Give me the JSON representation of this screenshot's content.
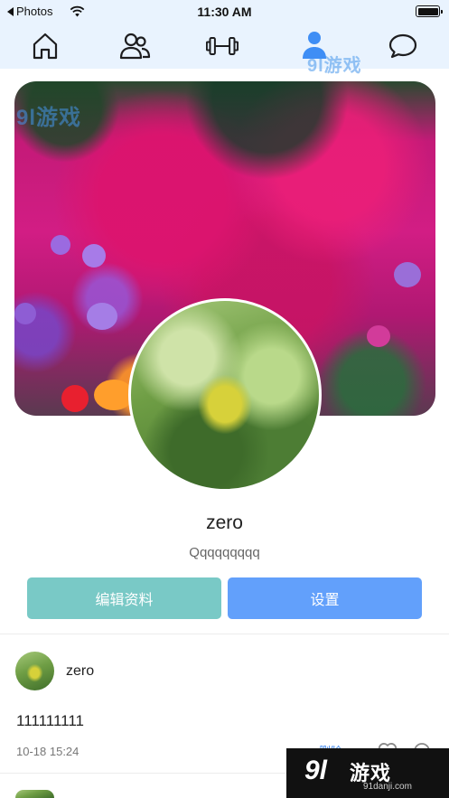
{
  "status_bar": {
    "back_label": "Photos",
    "time": "11:30 AM"
  },
  "tabs": [
    {
      "name": "home-icon",
      "active": false
    },
    {
      "name": "friends-icon",
      "active": false
    },
    {
      "name": "dumbbell-icon",
      "active": false
    },
    {
      "name": "user-icon",
      "active": true
    },
    {
      "name": "chat-bubble-icon",
      "active": false
    }
  ],
  "watermark": {
    "logo": "9l游戏",
    "url": "91danji.com"
  },
  "profile": {
    "name": "zero",
    "bio": "Qqqqqqqqq"
  },
  "actions": {
    "edit_label": "编辑资料",
    "settings_label": "设置"
  },
  "post": {
    "username": "zero",
    "content": "111111111",
    "time": "10-18 15:24",
    "delete_label": "删除"
  },
  "brand": {
    "logo": "9l",
    "name": "游戏",
    "url": "91danji.com"
  },
  "colors": {
    "header_bg": "#e9f3fe",
    "edit_button": "#79c9c6",
    "settings_button": "#62a0fb",
    "active_tab": "#3f8ef5"
  }
}
